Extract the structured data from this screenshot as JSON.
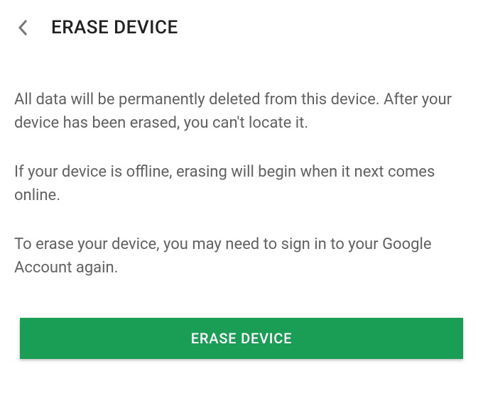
{
  "header": {
    "title": "ERASE DEVICE"
  },
  "content": {
    "paragraph1": "All data will be permanently deleted from this device. After your device has been erased, you can't locate it.",
    "paragraph2": "If your device is offline, erasing will begin when it next comes online.",
    "paragraph3": "To erase your device, you may need to sign in to your Google Account again."
  },
  "button": {
    "label": "ERASE DEVICE"
  }
}
